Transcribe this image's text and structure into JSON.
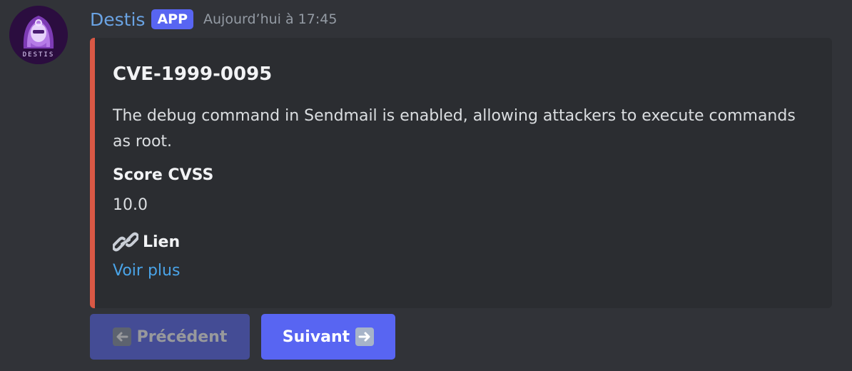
{
  "message": {
    "author": "Destis",
    "badge": "APP",
    "timestamp": "Aujourd’hui à 17:45",
    "avatar_label": "DESTIS",
    "avatar_icon": "hooded-robot-avatar"
  },
  "embed": {
    "accent_color": "#d95845",
    "title": "CVE-1999-0095",
    "description": "The debug command in Sendmail is enabled, allowing attackers to execute commands as root.",
    "fields": {
      "score_name": "Score CVSS",
      "score_value": "10.0",
      "link_name": "Lien",
      "link_icon": "link-icon",
      "link_text": "Voir plus"
    }
  },
  "buttons": {
    "previous_label": "Précédent",
    "previous_icon": "left-arrow-icon",
    "previous_disabled": true,
    "next_label": "Suivant",
    "next_icon": "right-arrow-icon",
    "color": "#5865f2"
  }
}
